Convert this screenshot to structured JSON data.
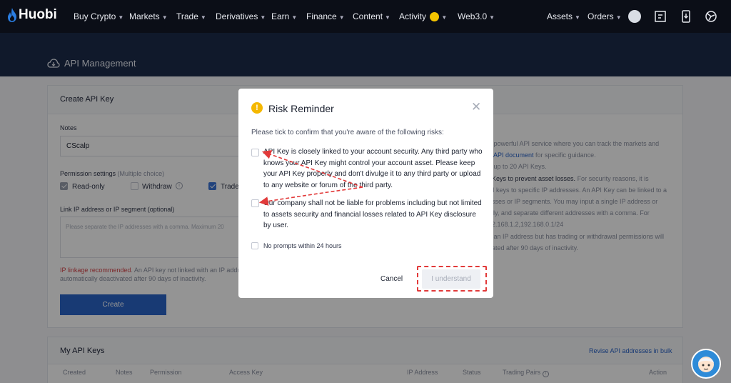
{
  "nav": {
    "logo": "Huobi",
    "items": [
      "Buy Crypto",
      "Markets",
      "Trade",
      "Derivatives",
      "Earn",
      "Finance",
      "Content",
      "Activity",
      "Web3.0"
    ],
    "assets": "Assets",
    "orders": "Orders"
  },
  "page": {
    "title": "API Management"
  },
  "create": {
    "title": "Create API Key",
    "notes_label": "Notes",
    "notes_value": "CScalp",
    "perm_label": "Permission settings",
    "perm_hint": "(Multiple choice)",
    "perm_read": "Read-only",
    "perm_withdraw": "Withdraw",
    "perm_trade": "Trade",
    "ip_label": "Link IP address or IP segment (optional)",
    "ip_placeholder": "Please separate the IP addresses with a comma. Maximum 20",
    "ip_warn": "IP linkage recommended",
    "ip_note1": ". An API key not linked with an IP addre",
    "ip_note2": "automatically deactivated after 90 days of inactivity.",
    "create_button": "Create"
  },
  "info": {
    "l1": "a powerful API service where you can track the markets and",
    "l2a": "d ",
    "l2link": "API document",
    "l2b": " for specific guidance.",
    "l3": "e up to 20 API Keys.",
    "l4a": "I Keys to prevent asset losses.",
    "l4b": " For security reasons, it is",
    "l5": "PI keys to specific IP addresses. An API Key can be linked to a",
    "l6": "esses or IP segments. You may input a single IP address or",
    "l7": "ctly, and separate different addresses with a comma. For",
    "l8": "92.168.1.2,192.168.0.1/24",
    "l9": "h an IP address but has trading or withdrawal permissions will",
    "l10": "pated after 90 days of inactivity."
  },
  "keys": {
    "title": "My API Keys",
    "revise": "Revise API addresses in bulk",
    "columns": [
      "Created",
      "Notes",
      "Permission",
      "Access Key",
      "IP Address",
      "Status",
      "Trading Pairs",
      "Action"
    ]
  },
  "modal": {
    "title": "Risk Reminder",
    "intro": "Please tick to confirm that you're aware of the following risks:",
    "risk1": "API Key is closely linked to your account security. Any third party who knows your API Key might control your account asset. Please keep your API Key properly and don't divulge it to any third party or upload to any website or forum of the third party.",
    "risk2": "Our company shall not be liable for problems including but not limited to assets security and financial losses related to API Key disclosure by user.",
    "no_prompt": "No prompts within 24 hours",
    "cancel": "Cancel",
    "understand": "I understand"
  },
  "colors": {
    "nav_bg": "#0b0e17",
    "band_bg": "#1c2b4a",
    "accent": "#2a64c8",
    "annotation": "#e23a3a",
    "warning": "#f5b800"
  }
}
